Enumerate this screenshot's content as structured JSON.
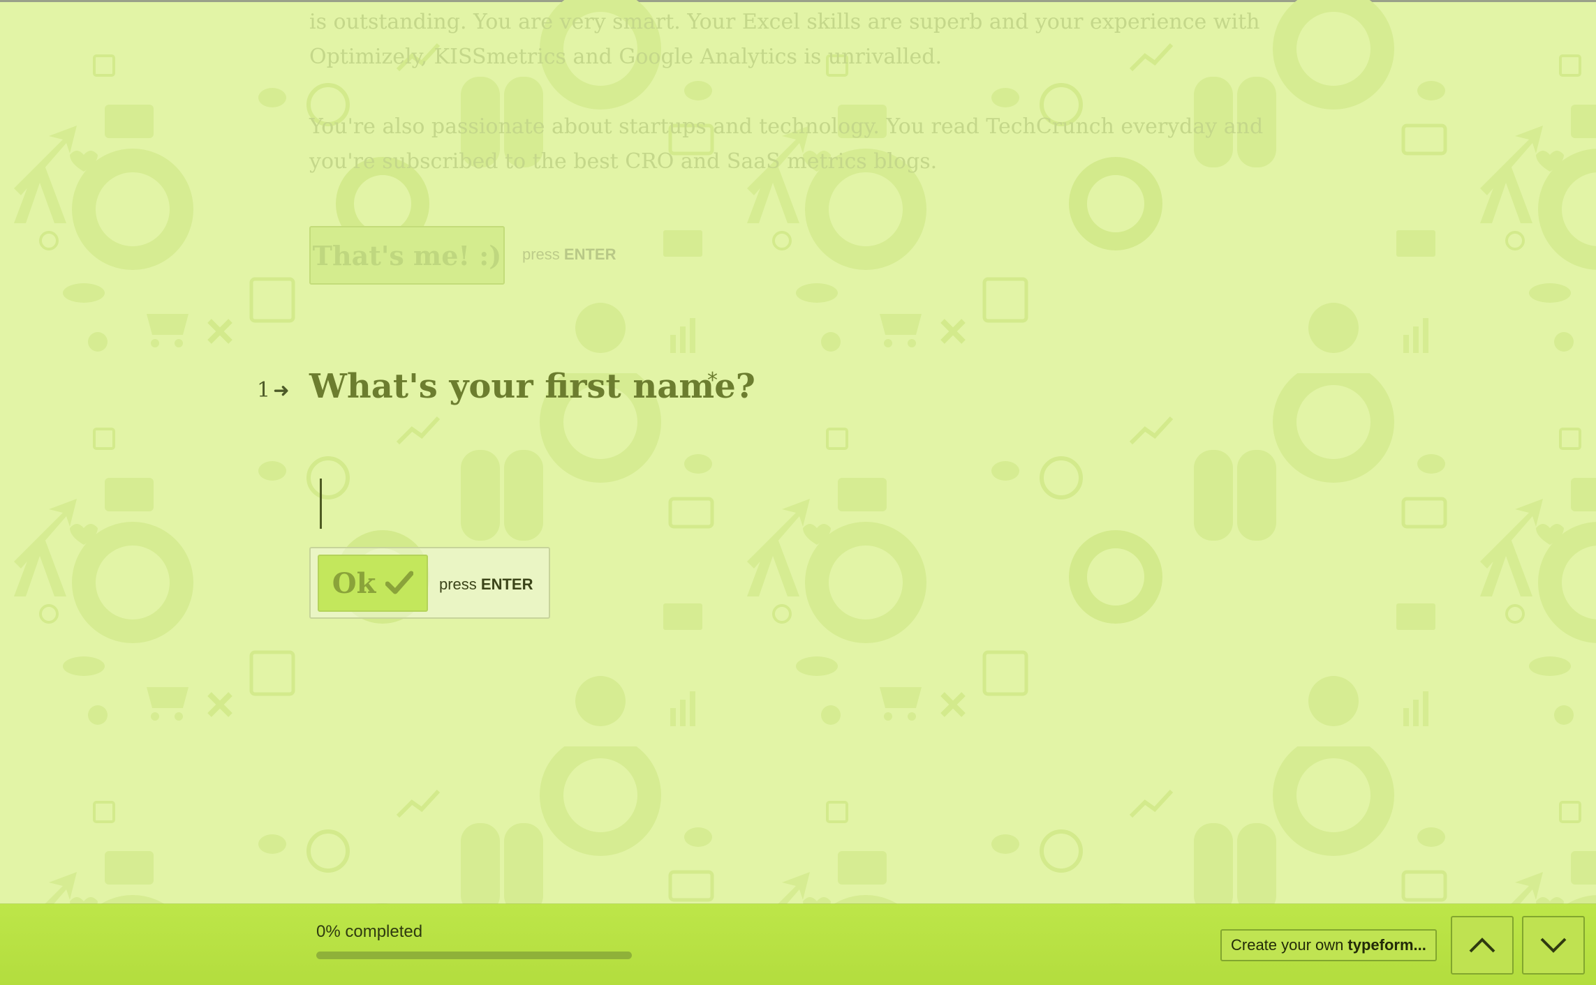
{
  "previous_question": {
    "paragraph_1_line_1": "is outstanding. You are very smart. Your Excel skills are superb and your experience with",
    "paragraph_1_line_2": "Optimizely, KISSmetrics and Google Analytics is unrivalled.",
    "paragraph_2_line_1": "You're also passionate about startups and technology. You read TechCrunch everyday and",
    "paragraph_2_line_2": "you're subscribed to the best CRO and SaaS metrics blogs.",
    "button_label": "That's me! :)",
    "hint_prefix": "press",
    "hint_key": "ENTER"
  },
  "question": {
    "number": "1",
    "arrow_icon": "arrow-right-icon",
    "title": "What's your first name?",
    "required_mark": "*",
    "answer_value": "",
    "ok_label": "Ok",
    "ok_icon": "checkmark-icon",
    "hint_prefix": "press",
    "hint_key": "ENTER"
  },
  "footer": {
    "progress_label": "0% completed",
    "progress_percent": 0,
    "create_prefix": "Create your own",
    "create_brand": "typeform...",
    "up_icon": "chevron-up-icon",
    "down_icon": "chevron-down-icon"
  },
  "colors": {
    "background": "#e2f4a6",
    "accent": "#b8e245",
    "question_text": "#6c7d2f",
    "progress_fill": "#5d7b18"
  }
}
